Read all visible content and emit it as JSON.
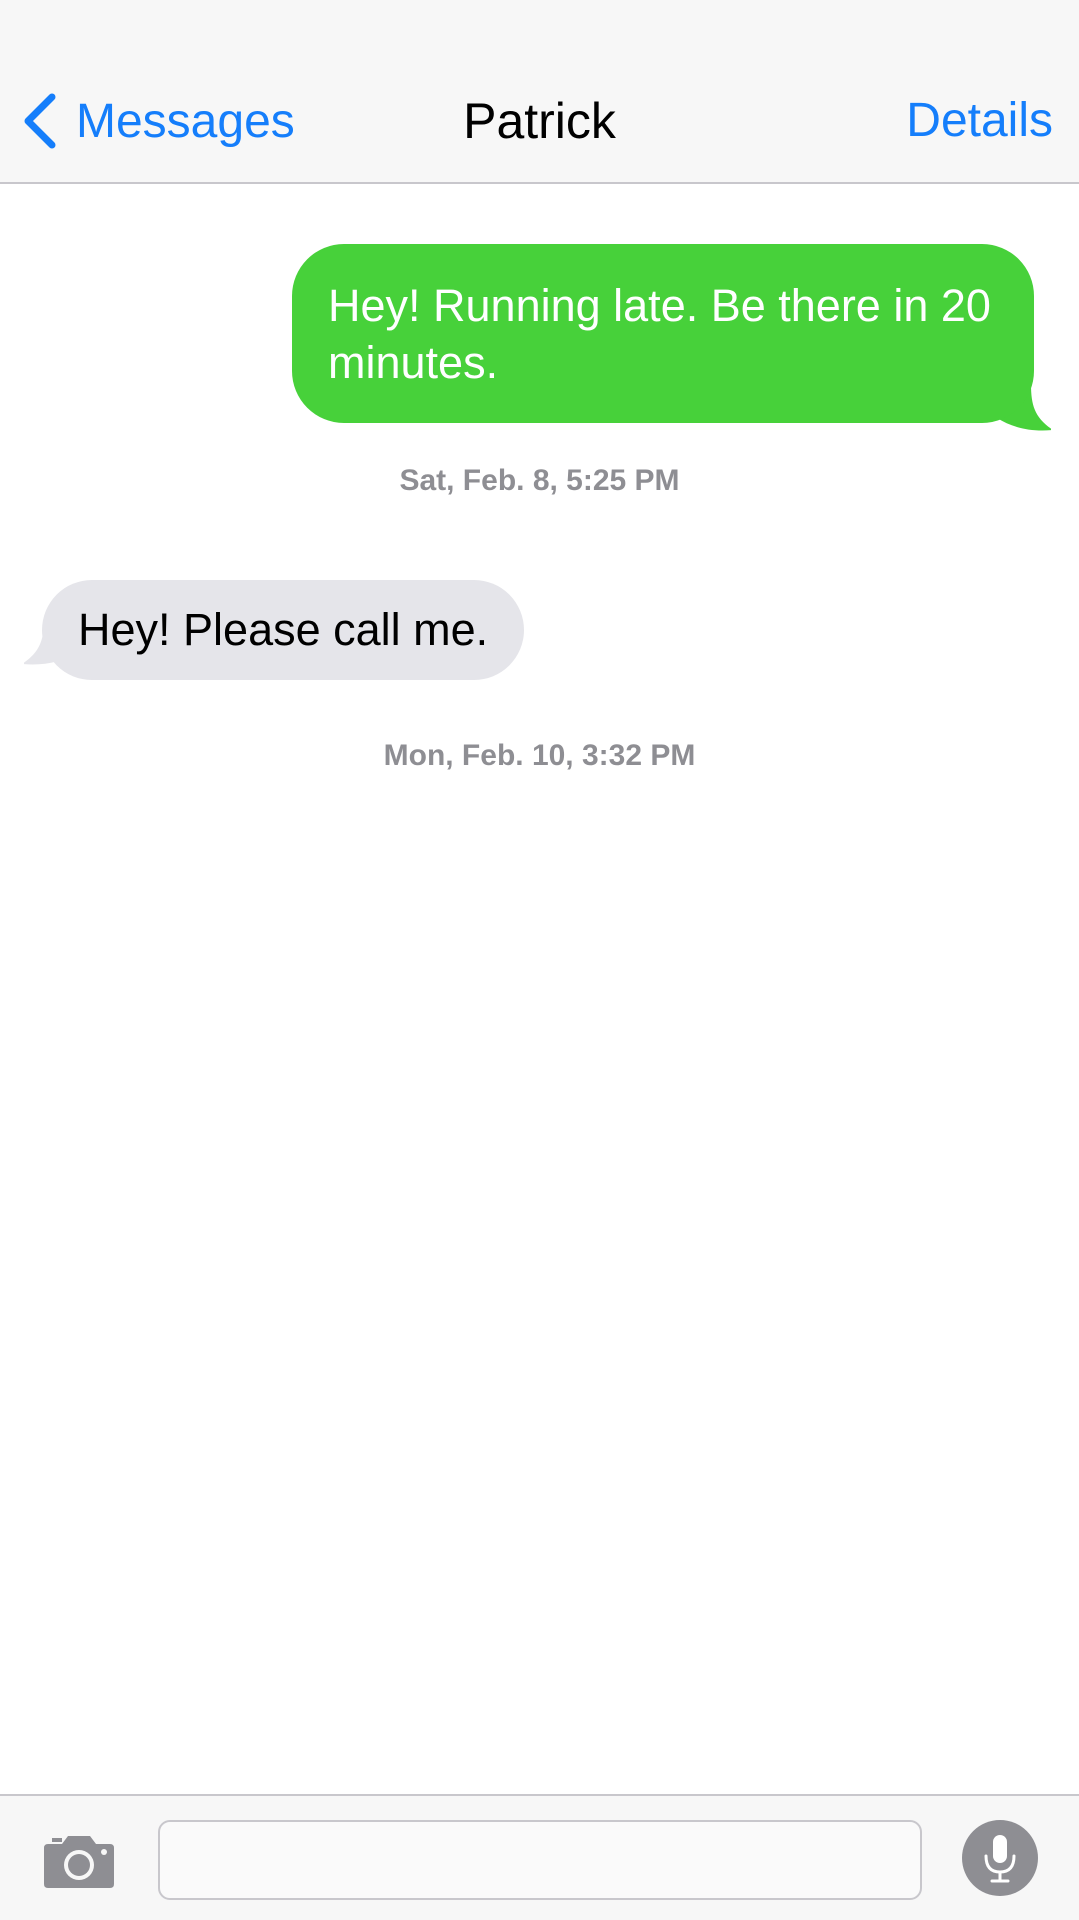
{
  "navbar": {
    "back_label": "Messages",
    "title": "Patrick",
    "details_label": "Details"
  },
  "messages": [
    {
      "direction": "outgoing",
      "text": "Hey! Running late. Be there in 20 minutes."
    },
    {
      "direction": "timestamp",
      "text": "Sat, Feb. 8, 5:25 PM"
    },
    {
      "direction": "incoming",
      "text": "Hey! Please call me."
    },
    {
      "direction": "timestamp",
      "text": "Mon, Feb. 10, 3:32 PM"
    }
  ],
  "toolbar": {
    "input_value": "",
    "camera_icon": "camera-icon",
    "mic_icon": "microphone-icon"
  },
  "colors": {
    "accent": "#157efb",
    "outgoing_bubble": "#47d13a",
    "incoming_bubble": "#e5e5ea",
    "timestamp": "#8e8e93"
  }
}
